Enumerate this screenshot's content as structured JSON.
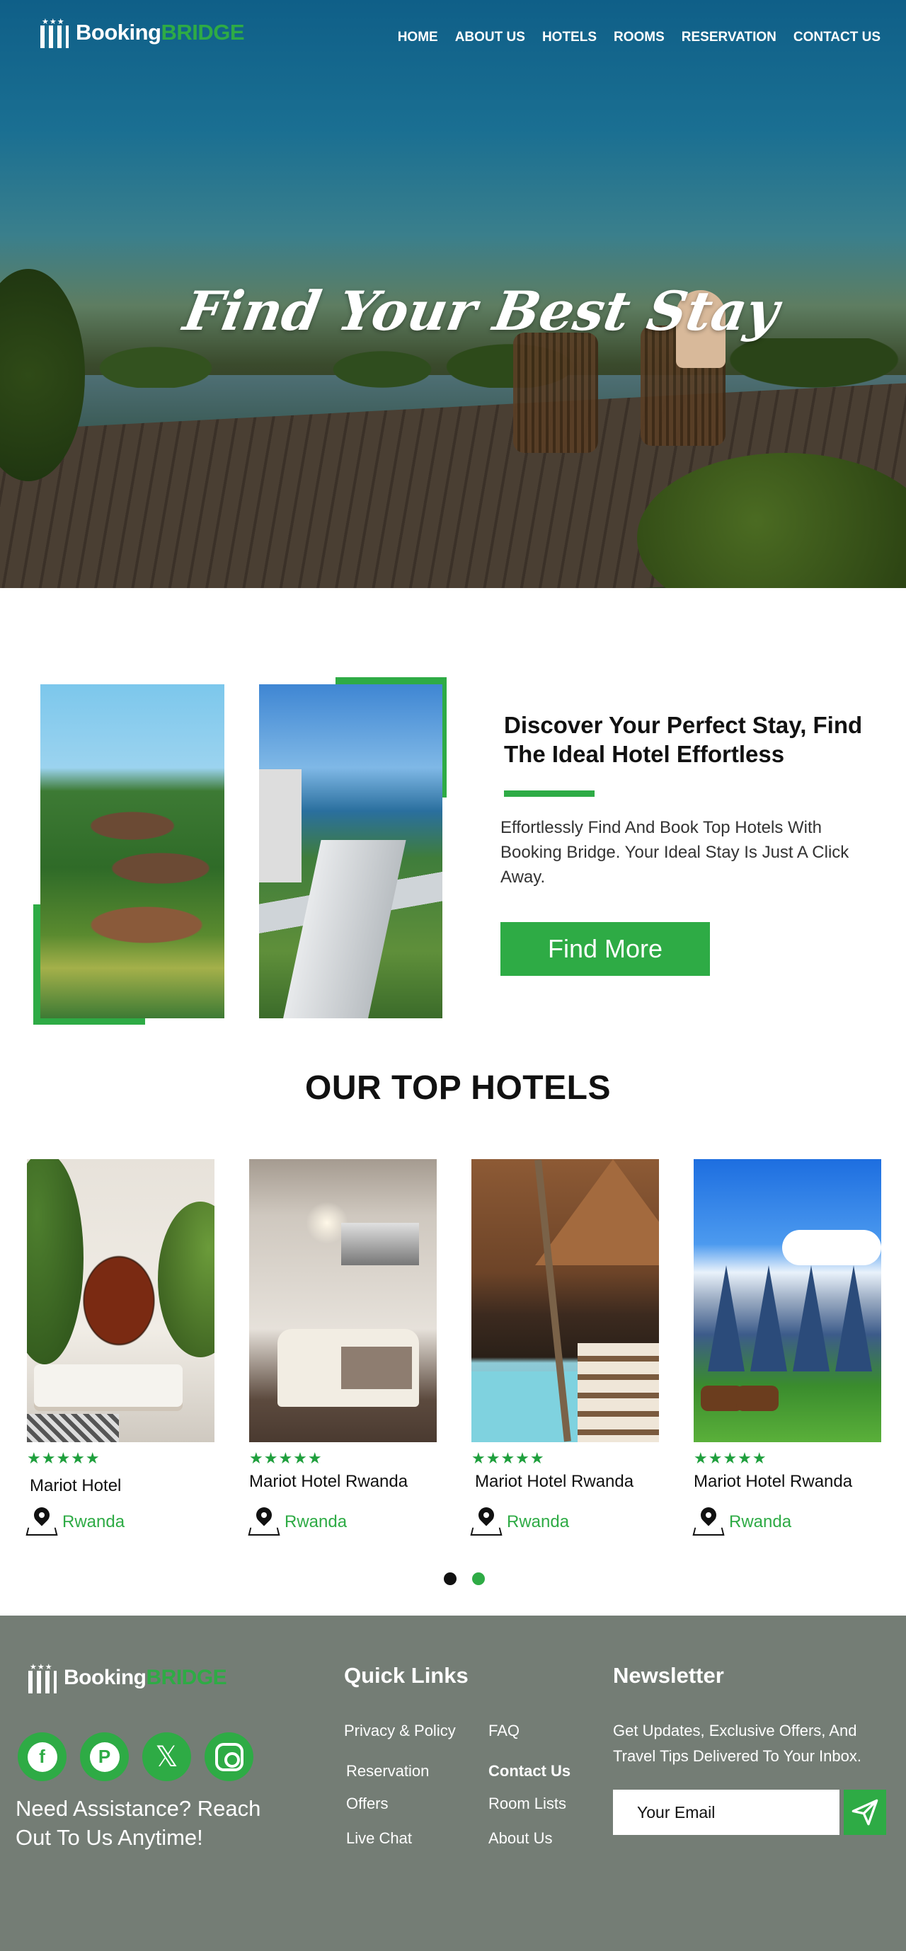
{
  "brand": {
    "part1": "Booking",
    "part2": "BRIDGE",
    "stars": "★★★"
  },
  "nav": [
    {
      "label": "HOME"
    },
    {
      "label": "ABOUT US"
    },
    {
      "label": "HOTELS"
    },
    {
      "label": "ROOMS"
    },
    {
      "label": "RESERVATION"
    },
    {
      "label": "CONTACT US"
    }
  ],
  "hero": {
    "title": "Find Your Best Stay"
  },
  "about": {
    "title": "Discover Your Perfect Stay, Find The Ideal Hotel Effortless",
    "text": "Effortlessly Find And Book Top Hotels With Booking Bridge. Your Ideal Stay Is Just A Click Away.",
    "button": "Find More"
  },
  "top_hotels": {
    "title": "OUR TOP HOTELS",
    "stars": "★★★★★",
    "items": [
      {
        "name": "Mariot Hotel",
        "location": "Rwanda"
      },
      {
        "name": "Mariot Hotel Rwanda",
        "location": "Rwanda"
      },
      {
        "name": "Mariot Hotel Rwanda",
        "location": "Rwanda"
      },
      {
        "name": "Mariot Hotel Rwanda",
        "location": "Rwanda"
      }
    ],
    "pagination": {
      "pages": 2,
      "current": 2
    }
  },
  "footer": {
    "assist": "Need Assistance? Reach Out To Us Anytime!",
    "social_icons": [
      "facebook-icon",
      "pinterest-icon",
      "x-icon",
      "instagram-icon"
    ],
    "quick_links_title": "Quick Links",
    "links_col1": [
      "Privacy & Policy",
      "Reservation",
      "Offers",
      "Live Chat"
    ],
    "links_col2": [
      "FAQ",
      "Contact Us",
      "Room Lists",
      "About Us"
    ],
    "newsletter_title": "Newsletter",
    "newsletter_text": "Get Updates, Exclusive Offers, And Travel Tips Delivered To Your Inbox.",
    "email_placeholder": "Your Email"
  },
  "colors": {
    "accent": "#2eab45",
    "footer_bg": "#747d75",
    "hero_sky": "#0f5f88"
  }
}
